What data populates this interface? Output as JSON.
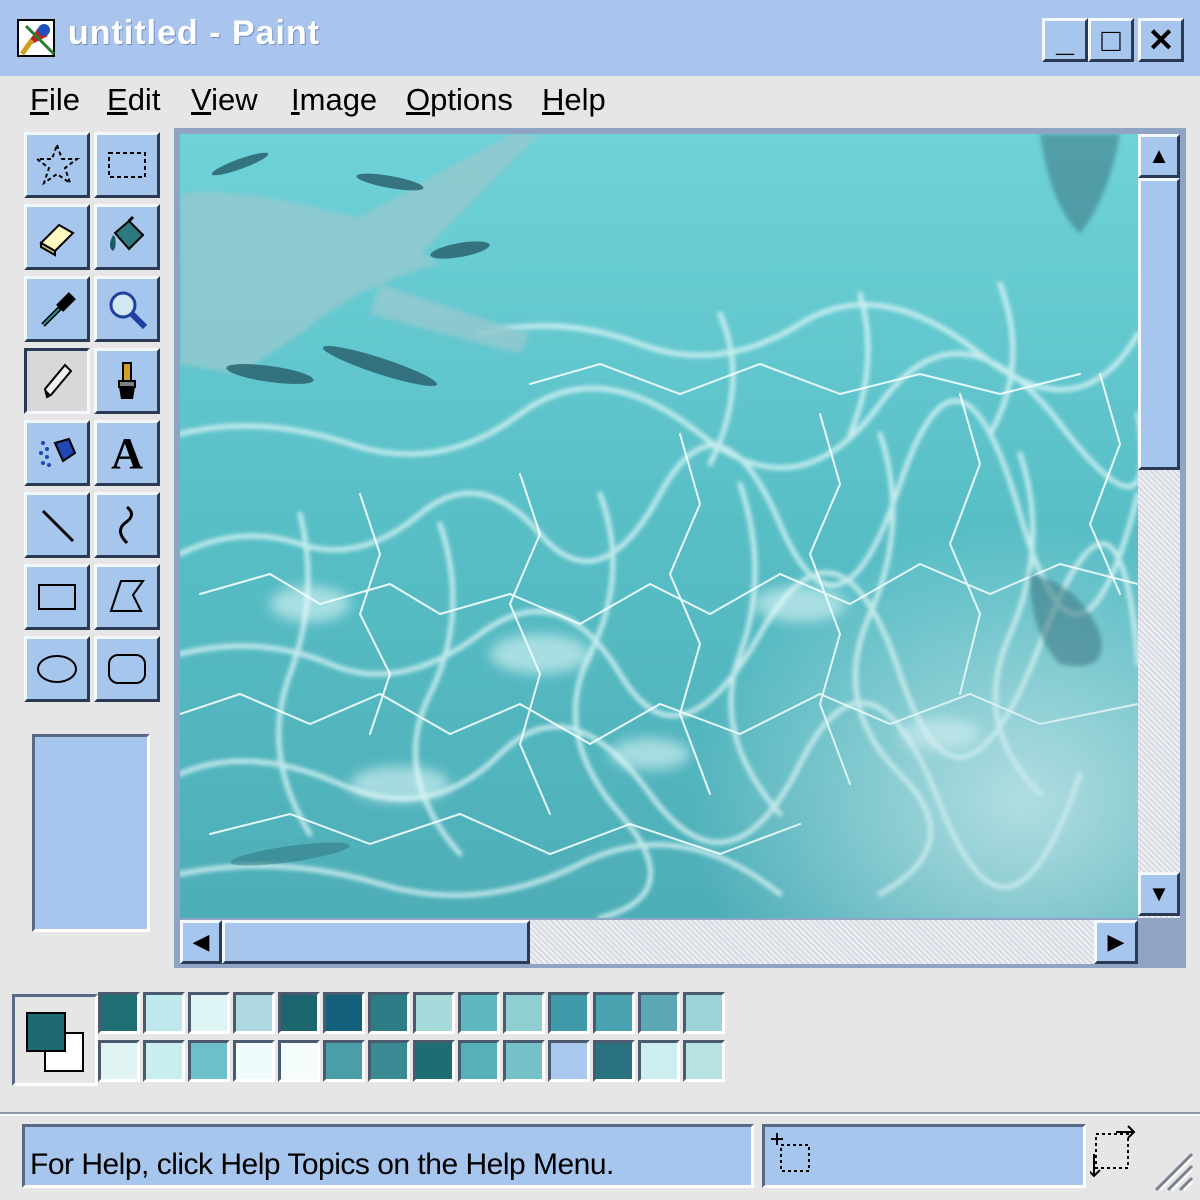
{
  "window": {
    "title": "untitled - Paint",
    "controls": [
      {
        "name": "minimize-button",
        "glyph": "_"
      },
      {
        "name": "maximize-button",
        "glyph": "□"
      },
      {
        "name": "close-button",
        "glyph": "✕"
      }
    ]
  },
  "menu": [
    "File",
    "Edit",
    "View",
    "Image",
    "Options",
    "Help"
  ],
  "tools": [
    {
      "name": "free-form-select",
      "icon": "free-select-icon"
    },
    {
      "name": "select",
      "icon": "rect-select-icon"
    },
    {
      "name": "eraser",
      "icon": "eraser-icon"
    },
    {
      "name": "fill-with-color",
      "icon": "fill-bucket-icon"
    },
    {
      "name": "pick-color",
      "icon": "eyedropper-icon"
    },
    {
      "name": "magnifier",
      "icon": "magnifier-icon"
    },
    {
      "name": "pencil",
      "icon": "pencil-icon",
      "active": true
    },
    {
      "name": "brush",
      "icon": "brush-icon"
    },
    {
      "name": "airbrush",
      "icon": "airbrush-icon"
    },
    {
      "name": "text",
      "icon": "text-icon",
      "glyph": "A"
    },
    {
      "name": "line",
      "icon": "line-icon"
    },
    {
      "name": "curve",
      "icon": "curve-icon"
    },
    {
      "name": "rectangle",
      "icon": "rectangle-icon"
    },
    {
      "name": "polygon",
      "icon": "polygon-icon"
    },
    {
      "name": "ellipse",
      "icon": "ellipse-icon"
    },
    {
      "name": "rounded-rectangle",
      "icon": "rounded-rect-icon"
    }
  ],
  "colors": {
    "foreground": "#1f6a72",
    "background": "#ffffff",
    "palette_row1": [
      "#1e6e74",
      "#bfe8ec",
      "#dff4f4",
      "#aed8e0",
      "#1d6670",
      "#145f7c",
      "#2c7c86",
      "#a7dada",
      "#5db8c2",
      "#8fcfd2",
      "#3f9aaa",
      "#4aa3b0",
      "#5ca8b4",
      "#9cd3d8"
    ],
    "palette_row2": [
      "#e0f4f4",
      "#c8eef0",
      "#6ec0c8",
      "#f0fbfb",
      "#f4fcfc",
      "#4a9ea8",
      "#3a8a94",
      "#1c6e72",
      "#56b0b8",
      "#74c2c8",
      "#a9c8ee",
      "#2a7280",
      "#cdeeee",
      "#b6e2e2"
    ]
  },
  "scrollbars": {
    "up": "▲",
    "down": "▼",
    "left": "◀",
    "right": "▶"
  },
  "status": {
    "help_text": "For Help, click Help Topics on the Help Menu."
  }
}
